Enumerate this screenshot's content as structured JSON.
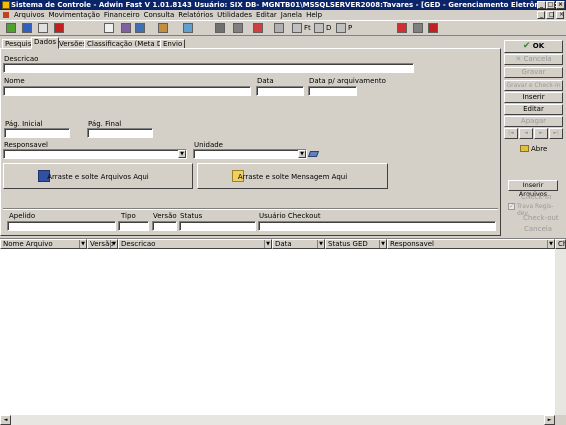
{
  "window": {
    "title": "Sistema de Controle - Adwin Fast      V 1.01.8143      Usuário: SIX      DB- MGNTB01\\MSSQLSERVER2008:Tavares - [GED - Gerenciamento Eletrônico de Do]",
    "minimize": "_",
    "maximize": "□",
    "close": "×"
  },
  "menu": {
    "items": [
      "Arquivos",
      "Movimentação",
      "Financeiro",
      "Consulta",
      "Relatórios",
      "Utilidades",
      "Editar",
      "Janela",
      "Help"
    ],
    "mdi_min": "_",
    "mdi_max": "□",
    "mdi_close": "×"
  },
  "toolbar": {
    "labels": [
      "Ft",
      "D",
      "P"
    ]
  },
  "tabs": [
    "Pesquisa",
    "Dados",
    "Versões",
    "Classificação (Meta Dados)",
    "Envio"
  ],
  "active_tab": 1,
  "form": {
    "descricao_label": "Descricao",
    "nome_label": "Nome",
    "data_label": "Data",
    "data_arquivamento_label": "Data p/ arquivamento",
    "pag_inicial_label": "Pág. Inicial",
    "pag_final_label": "Pág. Final",
    "responsavel_label": "Responsavel",
    "unidade_label": "Unidade",
    "apelido_label": "Apelido",
    "tipo_label": "Tipo",
    "versao_label": "Versão",
    "status_label": "Status",
    "usuario_checkout_label": "Usuário Checkout",
    "drop_arquivos": "Arraste e solte Arquivos Aqui",
    "drop_mensagem": "Arraste e solte Mensagem Aqui"
  },
  "side": {
    "ok": "OK",
    "cancela": "Cancela",
    "gravar": "Gravar",
    "gravar_checkin": "Gravar e Check-in",
    "inserir": "Inserir",
    "editar": "Editar",
    "apagar": "Apagar",
    "nav": [
      "|◄",
      "◄",
      "►",
      "►|"
    ],
    "abre": "Abre",
    "inserir_arquivos": "Inserir Arquivos",
    "checkin": "Check-in",
    "trava_registro": "Trava Regis- dev",
    "checkout": "Check-out",
    "cancela2": "Cancela"
  },
  "grid": {
    "columns": [
      "Nome Arquivo",
      "Versão",
      "Descricao",
      "Data",
      "Status GED",
      "Responsavel",
      "Ch"
    ]
  },
  "colors": {
    "titlebar": "#0a246a",
    "face": "#d4d0c8",
    "accent_green": "#2a8a2a"
  }
}
